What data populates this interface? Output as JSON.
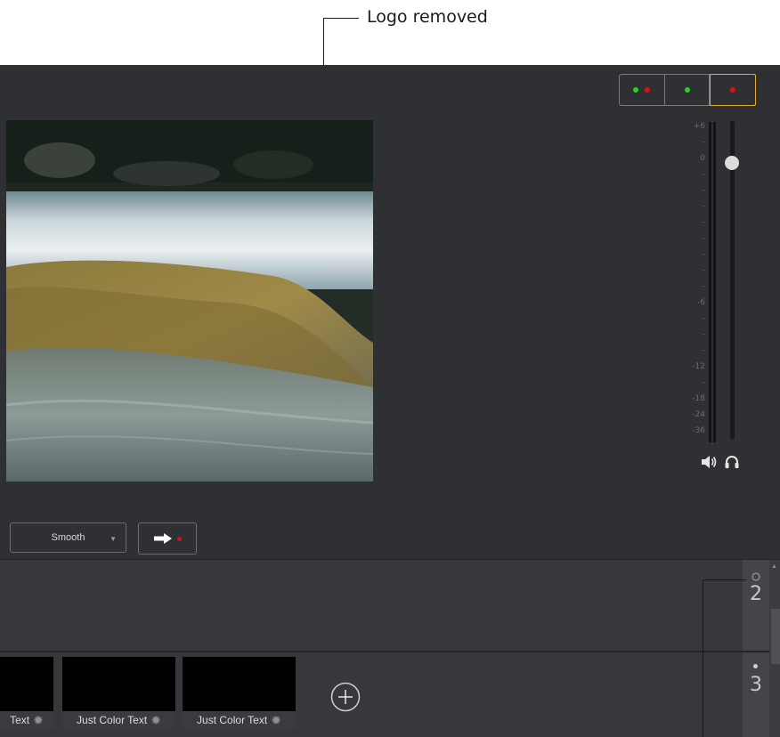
{
  "annotations": {
    "top_callout": "Logo removed"
  },
  "layers": [
    {
      "dots": [
        "#27d31f",
        "#e00f0f"
      ]
    },
    {
      "dots": [
        "#27d31f"
      ]
    },
    {
      "dots": [
        "#e00f0f"
      ],
      "active": true
    }
  ],
  "audio": {
    "scale_labels": [
      "+6",
      "-",
      "0",
      "-",
      "-",
      "-",
      "-",
      "-",
      "-",
      "-",
      "-",
      "-6",
      "-",
      "-",
      "-",
      "-12",
      "-",
      "-18",
      "-24",
      "-36"
    ],
    "fader_level": 0.86
  },
  "transition": {
    "mode": "Smooth"
  },
  "rows": [
    {
      "number": "2"
    },
    {
      "number": "3"
    }
  ],
  "clips": [
    {
      "label": "Text"
    },
    {
      "label": "Just Color Text"
    },
    {
      "label": "Just Color Text"
    }
  ],
  "colors": {
    "background": "#2f3033",
    "row": "#37383b",
    "active_layer_border": "#e8a92a",
    "live_red": "#e00f0f",
    "preview_green": "#27d31f"
  }
}
